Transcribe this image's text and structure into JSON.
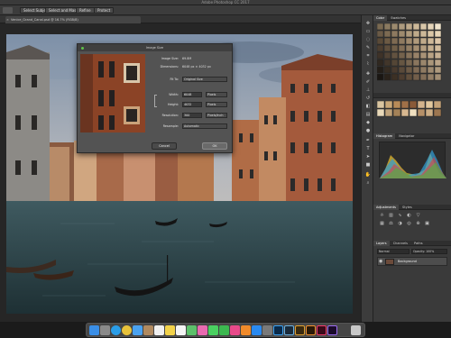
{
  "window": {
    "app_title": "Adobe Photoshop CC 2017"
  },
  "options_bar": {
    "buttons": [
      "Select Subject",
      "Select and Mask...",
      "Refine",
      "Protect"
    ]
  },
  "document": {
    "tab_title": "Venice_Grand_Canal.psd @ 16.7% (RGB/8)"
  },
  "dialog": {
    "title": "Image Size",
    "image_size_label": "Image Size:",
    "image_size_value": "69.8M",
    "dimensions_label": "Dimensions:",
    "dimensions_value": "6048 px × 4032 px",
    "fit_to_label": "Fit To:",
    "fit_to_value": "Original Size",
    "width_label": "Width:",
    "width_value": "6048",
    "width_unit": "Pixels",
    "height_label": "Height:",
    "height_value": "4032",
    "height_unit": "Pixels",
    "resolution_label": "Resolution:",
    "resolution_value": "300",
    "resolution_unit": "Pixels/Inch",
    "resample_label": "Resample:",
    "resample_value": "Automatic",
    "cancel_label": "Cancel",
    "ok_label": "OK"
  },
  "panels": {
    "swatches_tabs": [
      "Color",
      "Swatches"
    ],
    "histogram_tabs": [
      "Histogram",
      "Navigator"
    ],
    "adjustments_tabs": [
      "Adjustments",
      "Styles"
    ],
    "layers_tabs": [
      "Layers",
      "Channels",
      "Paths"
    ],
    "layer_name": "Background",
    "blend_mode": "Normal",
    "opacity": "Opacity: 100%"
  },
  "colors": {
    "app_bg": "#2b2b2b",
    "panel_bg": "#3a3a3a",
    "dialog_bg": "#535353",
    "accent_ok": "#6a6a6a"
  },
  "icons": {
    "tools": [
      "move-icon",
      "marquee-icon",
      "lasso-icon",
      "quick-select-icon",
      "crop-icon",
      "eyedropper-icon",
      "healing-icon",
      "brush-icon",
      "stamp-icon",
      "history-brush-icon",
      "eraser-icon",
      "gradient-icon",
      "blur-icon",
      "dodge-icon",
      "pen-icon",
      "type-icon",
      "path-select-icon",
      "shape-icon",
      "hand-icon",
      "zoom-icon"
    ],
    "dock": [
      "finder-icon",
      "launchpad-icon",
      "safari-icon",
      "chrome-icon",
      "mail-icon",
      "contacts-icon",
      "calendar-icon",
      "notes-icon",
      "reminders-icon",
      "maps-icon",
      "photos-icon",
      "messages-icon",
      "facetime-icon",
      "itunes-icon",
      "ibooks-icon",
      "appstore-icon",
      "preferences-icon",
      "photoshop-icon",
      "lightroom-icon",
      "bridge-icon",
      "illustrator-icon",
      "indesign-icon",
      "premiere-icon",
      "trash-icon"
    ]
  }
}
